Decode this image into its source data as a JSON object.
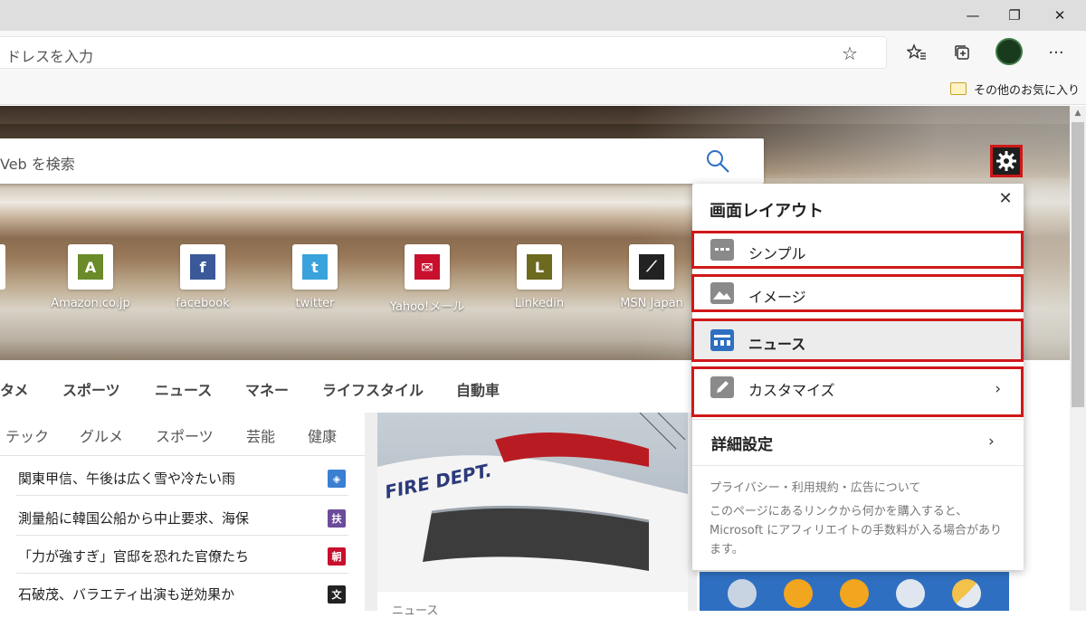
{
  "window": {
    "minimize_glyph": "—",
    "restore_glyph": "❐",
    "close_glyph": "✕"
  },
  "toolbar": {
    "address_placeholder": "ドレスを入力",
    "star_glyph": "☆",
    "favorites_glyph": "✩",
    "collections_glyph": "⧉",
    "more_glyph": "···"
  },
  "favorites_bar": {
    "other_favorites": "その他のお気に入り"
  },
  "hero": {
    "search_placeholder": "Veb を検索"
  },
  "quick_links": [
    {
      "label": "Amazon.co.jp",
      "letter": "A",
      "color": "#6b8a2a"
    },
    {
      "label": "facebook",
      "letter": "f",
      "color": "#3b5998"
    },
    {
      "label": "twitter",
      "letter": "t",
      "color": "#3aa3dc"
    },
    {
      "label": "Yahoo!メール",
      "letter": "✉",
      "color": "#c8102e"
    },
    {
      "label": "Linkedin",
      "letter": "L",
      "color": "#6b6a1f"
    },
    {
      "label": "MSN Japan",
      "letter": "⟋",
      "color": "#222222"
    }
  ],
  "categories": [
    "タメ",
    "スポーツ",
    "ニュース",
    "マネー",
    "ライフスタイル",
    "自動車"
  ],
  "news": {
    "subtabs": [
      "テック",
      "グルメ",
      "スポーツ",
      "芸能",
      "健康"
    ],
    "headlines": [
      {
        "text": "関東甲信、午後は広く雪や冷たい雨",
        "badge": "◈",
        "badge_color": "#3a7fd0"
      },
      {
        "text": "測量船に韓国公船から中止要求、海保",
        "badge": "扶",
        "badge_color": "#6b4b9a"
      },
      {
        "text": "「力が強すぎ」官邸を恐れた官僚たち",
        "badge": "朝",
        "badge_color": "#c8102e"
      },
      {
        "text": "石破茂、バラエティ出演も逆効果か",
        "badge": "文",
        "badge_color": "#222222"
      }
    ],
    "photo_text": "FIRE DEPT.",
    "photo_caption": "ニュース"
  },
  "layout_panel": {
    "title": "画面レイアウト",
    "close_glyph": "✕",
    "options": [
      {
        "label": "シンプル",
        "selected": false
      },
      {
        "label": "イメージ",
        "selected": false
      },
      {
        "label": "ニュース",
        "selected": true
      },
      {
        "label": "カスタマイズ",
        "selected": false
      }
    ],
    "chevron_glyph": "›",
    "detail_settings": "詳細設定",
    "privacy_link": "プライバシー・利用規約・広告について",
    "affiliate_notice": "このページにあるリンクから何かを購入すると、Microsoft にアフィリエイトの手数料が入る場合があります。"
  },
  "colors": {
    "highlight_border": "#d01818",
    "news_icon": "#2f6fc1",
    "weather_bg": "#2f6fc1"
  }
}
